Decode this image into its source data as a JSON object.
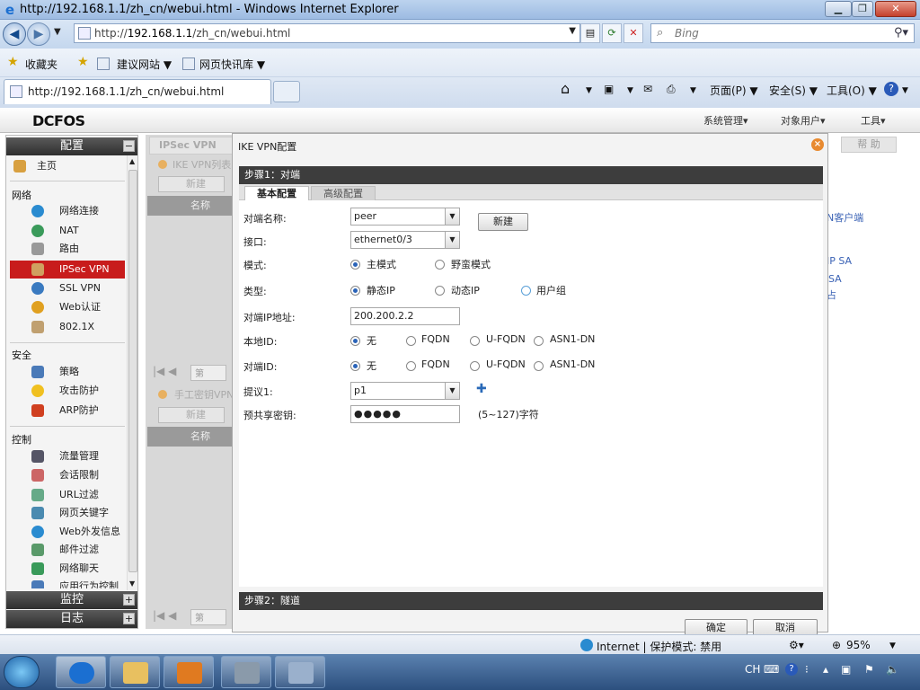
{
  "window": {
    "title": "http://192.168.1.1/zh_cn/webui.html - Windows Internet Explorer"
  },
  "address": {
    "prefix": "http://",
    "host": "192.168.1.1",
    "path": "/zh_cn/webui.html"
  },
  "search": {
    "placeholder": "Bing"
  },
  "favbar": {
    "favorites": "收藏夹",
    "suggested": "建议网站 ▼",
    "webslice": "网页快讯库 ▼"
  },
  "tab": {
    "title": "http://192.168.1.1/zh_cn/webui.html"
  },
  "commands": {
    "page": "页面(P) ▼",
    "safety": "安全(S) ▼",
    "tools": "工具(O) ▼"
  },
  "app": {
    "logo": "DCFOS",
    "topmenu": {
      "system": "系统管理▾",
      "objects": "对象用户▾",
      "tools": "工具▾"
    }
  },
  "sidebar": {
    "header": "配置",
    "groups": {
      "network": "网络",
      "security": "安全",
      "control": "控制"
    },
    "home": "主页",
    "network_items": [
      "网络连接",
      "NAT",
      "路由",
      "IPSec VPN",
      "SSL VPN",
      "Web认证",
      "802.1X"
    ],
    "security_items": [
      "策略",
      "攻击防护",
      "ARP防护"
    ],
    "control_items": [
      "流量管理",
      "会话限制",
      "URL过滤",
      "网页关键字",
      "Web外发信息",
      "邮件过滤",
      "网络聊天",
      "应用行为控制"
    ],
    "monitor": "监控",
    "log": "日志"
  },
  "background": {
    "tab": "IPSec VPN",
    "ike_list": "IKE VPN列表",
    "new": "新建",
    "name_col": "名称",
    "manual": "手工密钥VPN",
    "help": "帮 助",
    "right_texts": [
      "N客户端",
      "IP SA",
      "SA",
      "占"
    ],
    "page_label": "第"
  },
  "dialog": {
    "title": "IKE VPN配置",
    "step1": "步骤1：对端",
    "tabs": [
      "基本配置",
      "高级配置"
    ],
    "fields": {
      "peer_name_label": "对端名称:",
      "peer_name": "peer",
      "new_button": "新建",
      "interface_label": "接口:",
      "interface": "ethernet0/3",
      "mode_label": "模式:",
      "mode_main": "主模式",
      "mode_aggressive": "野蛮模式",
      "type_label": "类型:",
      "type_static": "静态IP",
      "type_dynamic": "动态IP",
      "type_usergroup": "用户组",
      "peer_ip_label": "对端IP地址:",
      "peer_ip": "200.200.2.2",
      "local_id_label": "本地ID:",
      "peer_id_label": "对端ID:",
      "id_none": "无",
      "id_fqdn": "FQDN",
      "id_ufqdn": "U-FQDN",
      "id_asn1": "ASN1-DN",
      "proposal_label": "提议1:",
      "proposal": "p1",
      "psk_label": "预共享密钥:",
      "psk": "●●●●●",
      "psk_hint": "(5~127)字符"
    },
    "step2": "步骤2：隧道",
    "ok": "确定",
    "cancel": "取消"
  },
  "status": {
    "zone": "Internet | 保护模式: 禁用",
    "zoom": "95%"
  },
  "taskbar": {
    "lang": "CH"
  }
}
